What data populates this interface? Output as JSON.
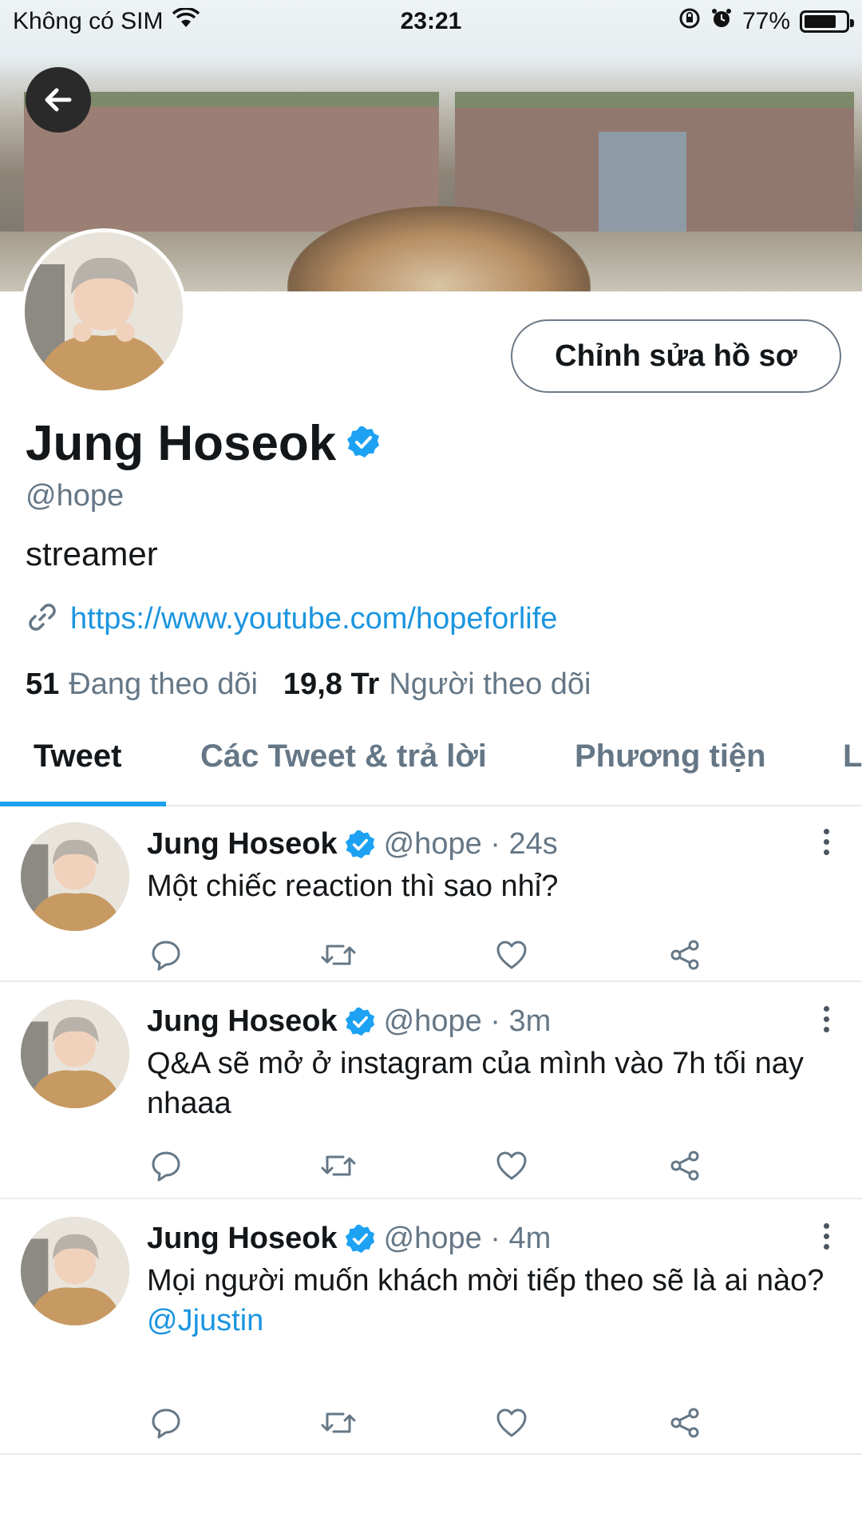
{
  "status_bar": {
    "carrier": "Không có SIM",
    "time": "23:21",
    "battery": "77%",
    "battery_level": 0.77
  },
  "profile": {
    "edit_button": "Chỉnh sửa hồ sơ",
    "name": "Jung Hoseok",
    "handle": "@hope",
    "bio": "streamer",
    "link": "https://www.youtube.com/hopeforlife",
    "following_count": "51",
    "following_label": "Đang theo dõi",
    "followers_count": "19,8 Tr",
    "followers_label": "Người theo dõi"
  },
  "tabs": [
    {
      "label": "Tweet"
    },
    {
      "label": "Các Tweet & trả lời"
    },
    {
      "label": "Phương tiện"
    },
    {
      "label": "L"
    }
  ],
  "tweets": [
    {
      "name": "Jung Hoseok",
      "meta": "@hope · 24s",
      "text": "Một chiếc reaction thì sao nhỉ?",
      "mention": ""
    },
    {
      "name": "Jung Hoseok",
      "meta": "@hope · 3m",
      "text": "Q&A sẽ mở ở instagram của mình vào 7h tối nay nhaaa",
      "mention": ""
    },
    {
      "name": "Jung Hoseok",
      "meta": "@hope · 4m",
      "text": "Mọi người muốn khách mời tiếp theo sẽ là ai nào?",
      "mention": "@Jjustin"
    }
  ],
  "colors": {
    "accent": "#1da1f2",
    "link": "#1b95e0",
    "muted": "#657786",
    "verified": "#1da1f2"
  },
  "icons": [
    "back-arrow-icon",
    "wifi-icon",
    "orientation-lock-icon",
    "alarm-icon",
    "battery-icon",
    "verified-badge-icon",
    "link-icon",
    "more-vertical-icon",
    "reply-icon",
    "retweet-icon",
    "like-icon",
    "share-icon"
  ]
}
